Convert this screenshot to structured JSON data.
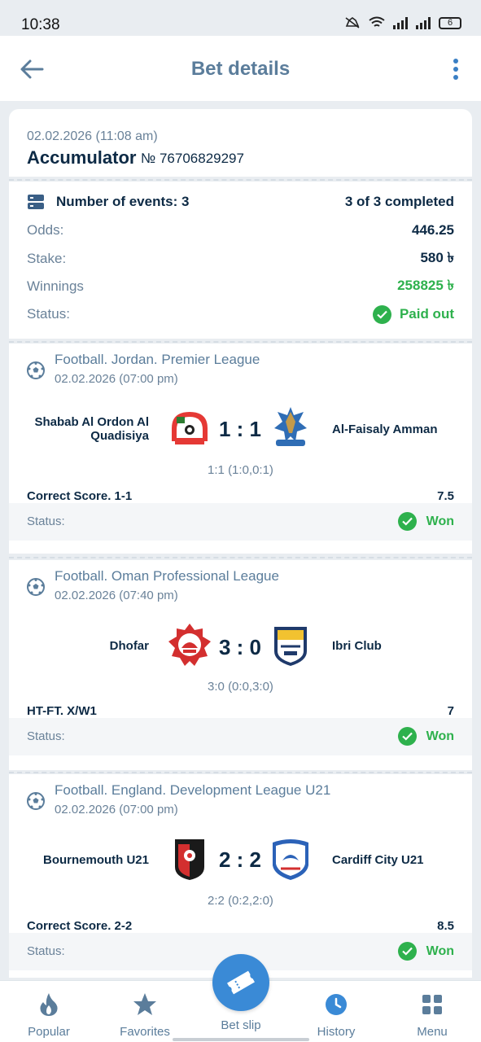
{
  "statusbar": {
    "time": "10:38",
    "battery": "6"
  },
  "header": {
    "title": "Bet details"
  },
  "bet": {
    "date": "02.02.2026 (11:08 am)",
    "type": "Accumulator",
    "number": "№ 76706829297"
  },
  "summary": {
    "events_label": "Number of events: 3",
    "events_value": "3 of 3 completed",
    "odds_label": "Odds:",
    "odds_value": "446.25",
    "stake_label": "Stake:",
    "stake_value": "580 ৳",
    "winnings_label": "Winnings",
    "winnings_value": "258825 ৳",
    "status_label": "Status:",
    "status_value": "Paid out"
  },
  "events": [
    {
      "league": "Football. Jordan. Premier League",
      "date": "02.02.2026 (07:00 pm)",
      "home": "Shabab Al Ordon Al Quadisiya",
      "away": "Al-Faisaly Amman",
      "score": "1 : 1",
      "score_detail": "1:1 (1:0,0:1)",
      "market": "Correct Score. 1-1",
      "odds": "7.5",
      "status_label": "Status:",
      "status": "Won"
    },
    {
      "league": "Football. Oman Professional League",
      "date": "02.02.2026 (07:40 pm)",
      "home": "Dhofar",
      "away": "Ibri Club",
      "score": "3 : 0",
      "score_detail": "3:0 (0:0,3:0)",
      "market": "HT-FT. X/W1",
      "odds": "7",
      "status_label": "Status:",
      "status": "Won"
    },
    {
      "league": "Football. England. Development League U21",
      "date": "02.02.2026 (07:00 pm)",
      "home": "Bournemouth U21",
      "away": "Cardiff City U21",
      "score": "2 : 2",
      "score_detail": "2:2 (0:2,2:0)",
      "market": "Correct Score. 2-2",
      "odds": "8.5",
      "status_label": "Status:",
      "status": "Won"
    }
  ],
  "nav": {
    "popular": "Popular",
    "favorites": "Favorites",
    "betslip": "Bet slip",
    "history": "History",
    "menu": "Menu"
  },
  "colors": {
    "accent": "#3a8ad6",
    "success": "#2eb14d",
    "text": "#0d2a45",
    "muted": "#6a8299",
    "background": "#e9edf1"
  }
}
